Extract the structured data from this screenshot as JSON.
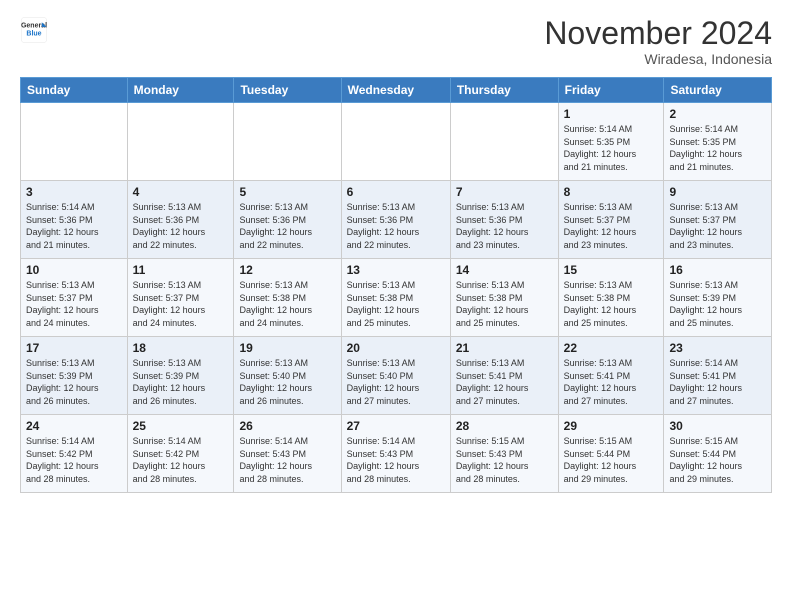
{
  "header": {
    "logo_line1": "General",
    "logo_line2": "Blue",
    "month": "November 2024",
    "location": "Wiradesa, Indonesia"
  },
  "days_of_week": [
    "Sunday",
    "Monday",
    "Tuesday",
    "Wednesday",
    "Thursday",
    "Friday",
    "Saturday"
  ],
  "weeks": [
    [
      {
        "day": "",
        "info": ""
      },
      {
        "day": "",
        "info": ""
      },
      {
        "day": "",
        "info": ""
      },
      {
        "day": "",
        "info": ""
      },
      {
        "day": "",
        "info": ""
      },
      {
        "day": "1",
        "info": "Sunrise: 5:14 AM\nSunset: 5:35 PM\nDaylight: 12 hours\nand 21 minutes."
      },
      {
        "day": "2",
        "info": "Sunrise: 5:14 AM\nSunset: 5:35 PM\nDaylight: 12 hours\nand 21 minutes."
      }
    ],
    [
      {
        "day": "3",
        "info": "Sunrise: 5:14 AM\nSunset: 5:36 PM\nDaylight: 12 hours\nand 21 minutes."
      },
      {
        "day": "4",
        "info": "Sunrise: 5:13 AM\nSunset: 5:36 PM\nDaylight: 12 hours\nand 22 minutes."
      },
      {
        "day": "5",
        "info": "Sunrise: 5:13 AM\nSunset: 5:36 PM\nDaylight: 12 hours\nand 22 minutes."
      },
      {
        "day": "6",
        "info": "Sunrise: 5:13 AM\nSunset: 5:36 PM\nDaylight: 12 hours\nand 22 minutes."
      },
      {
        "day": "7",
        "info": "Sunrise: 5:13 AM\nSunset: 5:36 PM\nDaylight: 12 hours\nand 23 minutes."
      },
      {
        "day": "8",
        "info": "Sunrise: 5:13 AM\nSunset: 5:37 PM\nDaylight: 12 hours\nand 23 minutes."
      },
      {
        "day": "9",
        "info": "Sunrise: 5:13 AM\nSunset: 5:37 PM\nDaylight: 12 hours\nand 23 minutes."
      }
    ],
    [
      {
        "day": "10",
        "info": "Sunrise: 5:13 AM\nSunset: 5:37 PM\nDaylight: 12 hours\nand 24 minutes."
      },
      {
        "day": "11",
        "info": "Sunrise: 5:13 AM\nSunset: 5:37 PM\nDaylight: 12 hours\nand 24 minutes."
      },
      {
        "day": "12",
        "info": "Sunrise: 5:13 AM\nSunset: 5:38 PM\nDaylight: 12 hours\nand 24 minutes."
      },
      {
        "day": "13",
        "info": "Sunrise: 5:13 AM\nSunset: 5:38 PM\nDaylight: 12 hours\nand 25 minutes."
      },
      {
        "day": "14",
        "info": "Sunrise: 5:13 AM\nSunset: 5:38 PM\nDaylight: 12 hours\nand 25 minutes."
      },
      {
        "day": "15",
        "info": "Sunrise: 5:13 AM\nSunset: 5:38 PM\nDaylight: 12 hours\nand 25 minutes."
      },
      {
        "day": "16",
        "info": "Sunrise: 5:13 AM\nSunset: 5:39 PM\nDaylight: 12 hours\nand 25 minutes."
      }
    ],
    [
      {
        "day": "17",
        "info": "Sunrise: 5:13 AM\nSunset: 5:39 PM\nDaylight: 12 hours\nand 26 minutes."
      },
      {
        "day": "18",
        "info": "Sunrise: 5:13 AM\nSunset: 5:39 PM\nDaylight: 12 hours\nand 26 minutes."
      },
      {
        "day": "19",
        "info": "Sunrise: 5:13 AM\nSunset: 5:40 PM\nDaylight: 12 hours\nand 26 minutes."
      },
      {
        "day": "20",
        "info": "Sunrise: 5:13 AM\nSunset: 5:40 PM\nDaylight: 12 hours\nand 27 minutes."
      },
      {
        "day": "21",
        "info": "Sunrise: 5:13 AM\nSunset: 5:41 PM\nDaylight: 12 hours\nand 27 minutes."
      },
      {
        "day": "22",
        "info": "Sunrise: 5:13 AM\nSunset: 5:41 PM\nDaylight: 12 hours\nand 27 minutes."
      },
      {
        "day": "23",
        "info": "Sunrise: 5:14 AM\nSunset: 5:41 PM\nDaylight: 12 hours\nand 27 minutes."
      }
    ],
    [
      {
        "day": "24",
        "info": "Sunrise: 5:14 AM\nSunset: 5:42 PM\nDaylight: 12 hours\nand 28 minutes."
      },
      {
        "day": "25",
        "info": "Sunrise: 5:14 AM\nSunset: 5:42 PM\nDaylight: 12 hours\nand 28 minutes."
      },
      {
        "day": "26",
        "info": "Sunrise: 5:14 AM\nSunset: 5:43 PM\nDaylight: 12 hours\nand 28 minutes."
      },
      {
        "day": "27",
        "info": "Sunrise: 5:14 AM\nSunset: 5:43 PM\nDaylight: 12 hours\nand 28 minutes."
      },
      {
        "day": "28",
        "info": "Sunrise: 5:15 AM\nSunset: 5:43 PM\nDaylight: 12 hours\nand 28 minutes."
      },
      {
        "day": "29",
        "info": "Sunrise: 5:15 AM\nSunset: 5:44 PM\nDaylight: 12 hours\nand 29 minutes."
      },
      {
        "day": "30",
        "info": "Sunrise: 5:15 AM\nSunset: 5:44 PM\nDaylight: 12 hours\nand 29 minutes."
      }
    ]
  ]
}
